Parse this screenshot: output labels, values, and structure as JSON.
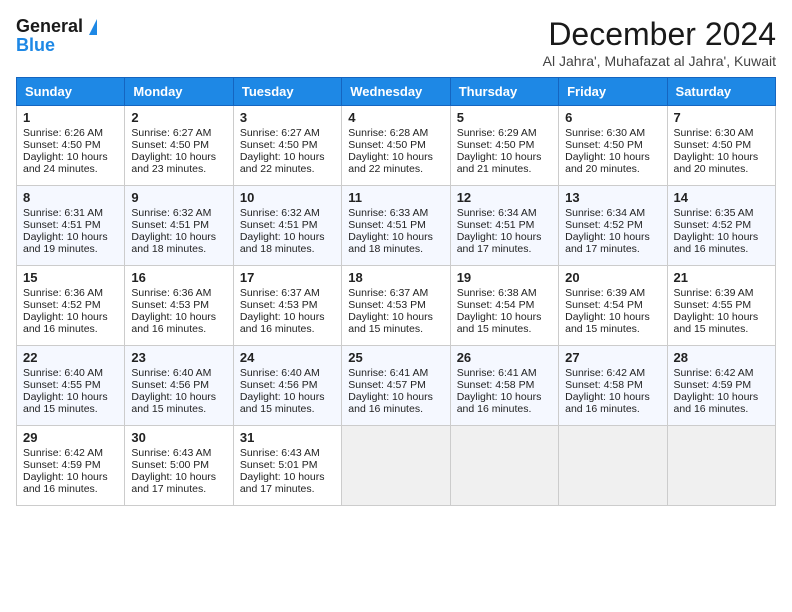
{
  "header": {
    "logo_general": "General",
    "logo_blue": "Blue",
    "title": "December 2024",
    "subtitle": "Al Jahra', Muhafazat al Jahra', Kuwait"
  },
  "days_of_week": [
    "Sunday",
    "Monday",
    "Tuesday",
    "Wednesday",
    "Thursday",
    "Friday",
    "Saturday"
  ],
  "weeks": [
    [
      {
        "day": "1",
        "lines": [
          "Sunrise: 6:26 AM",
          "Sunset: 4:50 PM",
          "Daylight: 10 hours",
          "and 24 minutes."
        ]
      },
      {
        "day": "2",
        "lines": [
          "Sunrise: 6:27 AM",
          "Sunset: 4:50 PM",
          "Daylight: 10 hours",
          "and 23 minutes."
        ]
      },
      {
        "day": "3",
        "lines": [
          "Sunrise: 6:27 AM",
          "Sunset: 4:50 PM",
          "Daylight: 10 hours",
          "and 22 minutes."
        ]
      },
      {
        "day": "4",
        "lines": [
          "Sunrise: 6:28 AM",
          "Sunset: 4:50 PM",
          "Daylight: 10 hours",
          "and 22 minutes."
        ]
      },
      {
        "day": "5",
        "lines": [
          "Sunrise: 6:29 AM",
          "Sunset: 4:50 PM",
          "Daylight: 10 hours",
          "and 21 minutes."
        ]
      },
      {
        "day": "6",
        "lines": [
          "Sunrise: 6:30 AM",
          "Sunset: 4:50 PM",
          "Daylight: 10 hours",
          "and 20 minutes."
        ]
      },
      {
        "day": "7",
        "lines": [
          "Sunrise: 6:30 AM",
          "Sunset: 4:50 PM",
          "Daylight: 10 hours",
          "and 20 minutes."
        ]
      }
    ],
    [
      {
        "day": "8",
        "lines": [
          "Sunrise: 6:31 AM",
          "Sunset: 4:51 PM",
          "Daylight: 10 hours",
          "and 19 minutes."
        ]
      },
      {
        "day": "9",
        "lines": [
          "Sunrise: 6:32 AM",
          "Sunset: 4:51 PM",
          "Daylight: 10 hours",
          "and 18 minutes."
        ]
      },
      {
        "day": "10",
        "lines": [
          "Sunrise: 6:32 AM",
          "Sunset: 4:51 PM",
          "Daylight: 10 hours",
          "and 18 minutes."
        ]
      },
      {
        "day": "11",
        "lines": [
          "Sunrise: 6:33 AM",
          "Sunset: 4:51 PM",
          "Daylight: 10 hours",
          "and 18 minutes."
        ]
      },
      {
        "day": "12",
        "lines": [
          "Sunrise: 6:34 AM",
          "Sunset: 4:51 PM",
          "Daylight: 10 hours",
          "and 17 minutes."
        ]
      },
      {
        "day": "13",
        "lines": [
          "Sunrise: 6:34 AM",
          "Sunset: 4:52 PM",
          "Daylight: 10 hours",
          "and 17 minutes."
        ]
      },
      {
        "day": "14",
        "lines": [
          "Sunrise: 6:35 AM",
          "Sunset: 4:52 PM",
          "Daylight: 10 hours",
          "and 16 minutes."
        ]
      }
    ],
    [
      {
        "day": "15",
        "lines": [
          "Sunrise: 6:36 AM",
          "Sunset: 4:52 PM",
          "Daylight: 10 hours",
          "and 16 minutes."
        ]
      },
      {
        "day": "16",
        "lines": [
          "Sunrise: 6:36 AM",
          "Sunset: 4:53 PM",
          "Daylight: 10 hours",
          "and 16 minutes."
        ]
      },
      {
        "day": "17",
        "lines": [
          "Sunrise: 6:37 AM",
          "Sunset: 4:53 PM",
          "Daylight: 10 hours",
          "and 16 minutes."
        ]
      },
      {
        "day": "18",
        "lines": [
          "Sunrise: 6:37 AM",
          "Sunset: 4:53 PM",
          "Daylight: 10 hours",
          "and 15 minutes."
        ]
      },
      {
        "day": "19",
        "lines": [
          "Sunrise: 6:38 AM",
          "Sunset: 4:54 PM",
          "Daylight: 10 hours",
          "and 15 minutes."
        ]
      },
      {
        "day": "20",
        "lines": [
          "Sunrise: 6:39 AM",
          "Sunset: 4:54 PM",
          "Daylight: 10 hours",
          "and 15 minutes."
        ]
      },
      {
        "day": "21",
        "lines": [
          "Sunrise: 6:39 AM",
          "Sunset: 4:55 PM",
          "Daylight: 10 hours",
          "and 15 minutes."
        ]
      }
    ],
    [
      {
        "day": "22",
        "lines": [
          "Sunrise: 6:40 AM",
          "Sunset: 4:55 PM",
          "Daylight: 10 hours",
          "and 15 minutes."
        ]
      },
      {
        "day": "23",
        "lines": [
          "Sunrise: 6:40 AM",
          "Sunset: 4:56 PM",
          "Daylight: 10 hours",
          "and 15 minutes."
        ]
      },
      {
        "day": "24",
        "lines": [
          "Sunrise: 6:40 AM",
          "Sunset: 4:56 PM",
          "Daylight: 10 hours",
          "and 15 minutes."
        ]
      },
      {
        "day": "25",
        "lines": [
          "Sunrise: 6:41 AM",
          "Sunset: 4:57 PM",
          "Daylight: 10 hours",
          "and 16 minutes."
        ]
      },
      {
        "day": "26",
        "lines": [
          "Sunrise: 6:41 AM",
          "Sunset: 4:58 PM",
          "Daylight: 10 hours",
          "and 16 minutes."
        ]
      },
      {
        "day": "27",
        "lines": [
          "Sunrise: 6:42 AM",
          "Sunset: 4:58 PM",
          "Daylight: 10 hours",
          "and 16 minutes."
        ]
      },
      {
        "day": "28",
        "lines": [
          "Sunrise: 6:42 AM",
          "Sunset: 4:59 PM",
          "Daylight: 10 hours",
          "and 16 minutes."
        ]
      }
    ],
    [
      {
        "day": "29",
        "lines": [
          "Sunrise: 6:42 AM",
          "Sunset: 4:59 PM",
          "Daylight: 10 hours",
          "and 16 minutes."
        ]
      },
      {
        "day": "30",
        "lines": [
          "Sunrise: 6:43 AM",
          "Sunset: 5:00 PM",
          "Daylight: 10 hours",
          "and 17 minutes."
        ]
      },
      {
        "day": "31",
        "lines": [
          "Sunrise: 6:43 AM",
          "Sunset: 5:01 PM",
          "Daylight: 10 hours",
          "and 17 minutes."
        ]
      },
      null,
      null,
      null,
      null
    ]
  ]
}
